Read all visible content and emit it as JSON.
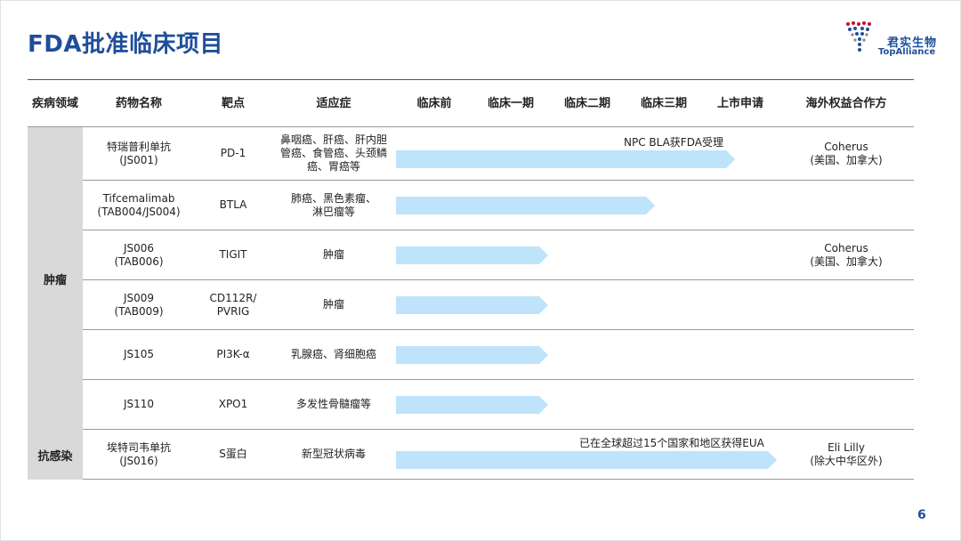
{
  "title": "FDA批准临床项目",
  "logo": {
    "cn": "君实生物",
    "en": "TopAlliance"
  },
  "headers": [
    "疾病领域",
    "药物名称",
    "靶点",
    "适应症",
    "临床前",
    "临床一期",
    "临床二期",
    "临床三期",
    "上市申请",
    "海外权益合作方"
  ],
  "categories": [
    {
      "label": "肿瘤"
    },
    {
      "label": "抗感染"
    }
  ],
  "rows": [
    {
      "drug": "特瑞普利单抗\n(JS001)",
      "target": "PD-1",
      "indication": "鼻咽癌、肝癌、肝内胆\n管癌、食管癌、头颈鳞\n癌、胃癌等",
      "stage_reached": "上市申请",
      "progress": 0.89,
      "note": "NPC BLA获FDA受理",
      "partner": "Coherus\n(美国、加拿大)"
    },
    {
      "drug": "Tifcemalimab\n(TAB004/JS004)",
      "target": "BTLA",
      "indication": "肺癌、黑色素瘤、\n淋巴瘤等",
      "stage_reached": "临床三期",
      "progress": 0.68,
      "note": "",
      "partner": ""
    },
    {
      "drug": "JS006\n(TAB006)",
      "target": "TIGIT",
      "indication": "肿瘤",
      "stage_reached": "临床一期",
      "progress": 0.4,
      "note": "",
      "partner": "Coherus\n(美国、加拿大)"
    },
    {
      "drug": "JS009\n(TAB009)",
      "target": "CD112R/\nPVRIG",
      "indication": "肿瘤",
      "stage_reached": "临床一期",
      "progress": 0.4,
      "note": "",
      "partner": ""
    },
    {
      "drug": "JS105",
      "target": "PI3K-α",
      "indication": "乳腺癌、肾细胞癌",
      "stage_reached": "临床一期",
      "progress": 0.4,
      "note": "",
      "partner": ""
    },
    {
      "drug": "JS110",
      "target": "XPO1",
      "indication": "多发性骨髓瘤等",
      "stage_reached": "临床一期",
      "progress": 0.4,
      "note": "",
      "partner": ""
    },
    {
      "drug": "埃特司韦单抗\n(JS016)",
      "target": "S蛋白",
      "indication": "新型冠状病毒",
      "stage_reached": "上市申请",
      "progress": 1.0,
      "note": "已在全球超过15个国家和地区获得EUA",
      "partner": "Eli Lilly\n(除大中华区外)"
    }
  ],
  "page_number": "6",
  "colors": {
    "title": "#1f4e9a",
    "bar": "#bfe3fb",
    "category_bg": "#d9d9d9"
  }
}
